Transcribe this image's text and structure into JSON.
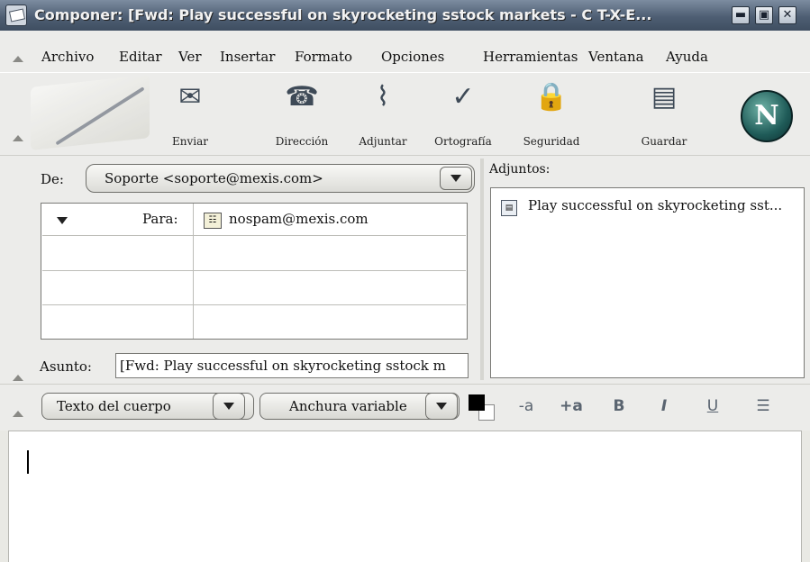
{
  "window": {
    "title": "Componer: [Fwd: Play successful on skyrocketing sstock markets - C T-X-E...",
    "buttons": {
      "minimize": "▬",
      "maximize": "▣",
      "close": "✕"
    }
  },
  "menu": {
    "items": [
      "Archivo",
      "Editar",
      "Ver",
      "Insertar",
      "Formato",
      "Opciones",
      "Herramientas",
      "Ventana",
      "Ayuda"
    ]
  },
  "toolbar": {
    "buttons": [
      {
        "label": "Enviar",
        "icon": "send-icon",
        "glyph": "✉"
      },
      {
        "label": "Dirección",
        "icon": "address-book-icon",
        "glyph": "☎"
      },
      {
        "label": "Adjuntar",
        "icon": "paperclip-icon",
        "glyph": "⌇"
      },
      {
        "label": "Ortografía",
        "icon": "spellcheck-icon",
        "glyph": "✓"
      },
      {
        "label": "Seguridad",
        "icon": "lock-icon",
        "glyph": "🔒"
      },
      {
        "label": "Guardar",
        "icon": "floppy-disk-icon",
        "glyph": "▤"
      }
    ],
    "logo": "N"
  },
  "header": {
    "from_label": "De:",
    "from_value": "Soporte <soporte@mexis.com>",
    "recipients": [
      {
        "type": "Para:",
        "address": "nospam@mexis.com"
      }
    ],
    "subject_label": "Asunto:",
    "subject_value": "[Fwd: Play successful on skyrocketing sstock m",
    "attachments_label": "Adjuntos:",
    "attachments": [
      "Play successful on skyrocketing sst..."
    ]
  },
  "format": {
    "paragraph_style": "Texto del cuerpo",
    "font": "Anchura variable",
    "buttons": [
      "-a",
      "+a",
      "B",
      "I",
      "U",
      "☰"
    ],
    "text_color": "#000000",
    "background_color": "#ffffff"
  },
  "body": {
    "text": ""
  }
}
